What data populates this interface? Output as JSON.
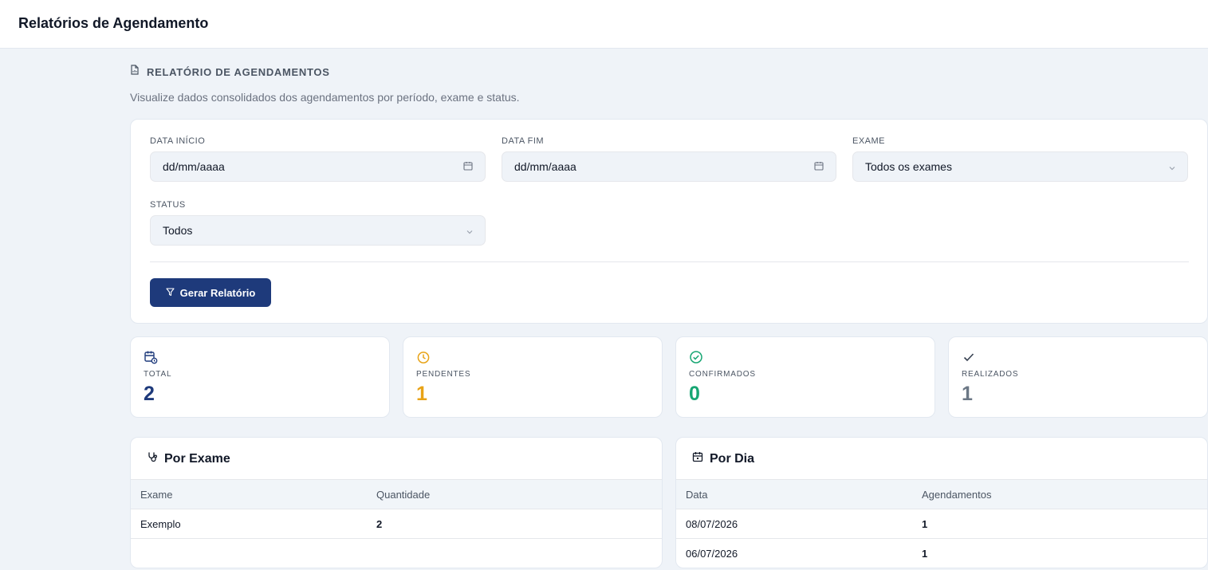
{
  "header": {
    "title": "Relatórios de Agendamento"
  },
  "section": {
    "title": "RELATÓRIO DE AGENDAMENTOS",
    "subtitle": "Visualize dados consolidados dos agendamentos por período, exame e status."
  },
  "filters": {
    "start_label": "DATA INÍCIO",
    "start_value": "dd/mm/aaaa",
    "end_label": "DATA FIM",
    "end_value": "dd/mm/aaaa",
    "exam_label": "EXAME",
    "exam_value": "Todos os exames",
    "status_label": "STATUS",
    "status_value": "Todos",
    "submit_label": "Gerar Relatório"
  },
  "stats": [
    {
      "label": "TOTAL",
      "value": "2",
      "color": "#1e3a7b"
    },
    {
      "label": "PENDENTES",
      "value": "1",
      "color": "#e8a317"
    },
    {
      "label": "CONFIRMADOS",
      "value": "0",
      "color": "#17a673"
    },
    {
      "label": "REALIZADOS",
      "value": "1",
      "color": "#6b7785"
    }
  ],
  "by_exam": {
    "title": "Por Exame",
    "columns": [
      "Exame",
      "Quantidade"
    ],
    "rows": [
      {
        "exam": "Exemplo",
        "count": "2"
      }
    ]
  },
  "by_day": {
    "title": "Por Dia",
    "columns": [
      "Data",
      "Agendamentos"
    ],
    "rows": [
      {
        "date": "08/07/2026",
        "count": "1"
      },
      {
        "date": "06/07/2026",
        "count": "1"
      }
    ]
  },
  "colors": {
    "primary": "#1e3a7b",
    "background": "#eff3f8"
  }
}
